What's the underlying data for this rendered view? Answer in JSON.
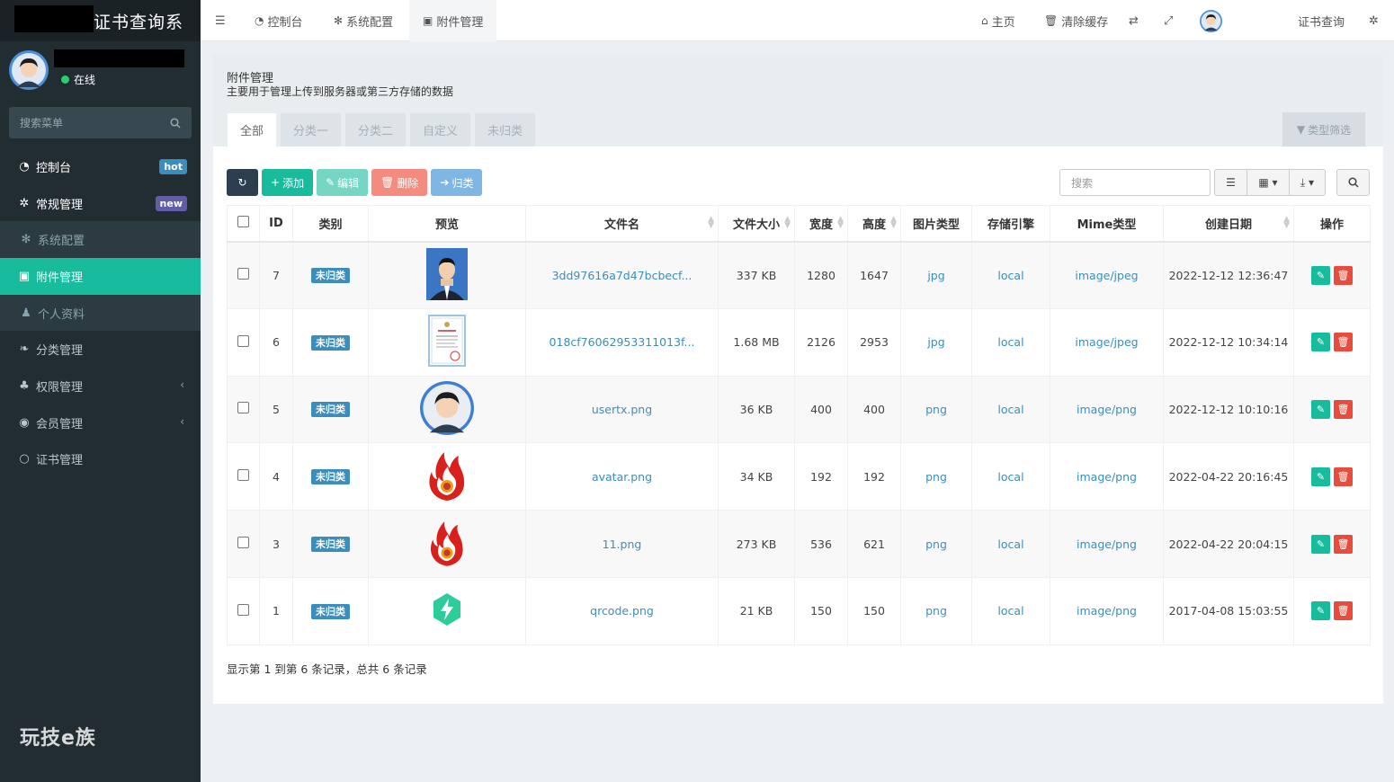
{
  "sidebar": {
    "logo_text": "证书查询系",
    "status": "在线",
    "search_placeholder": "搜索菜单",
    "items": [
      {
        "label": "控制台",
        "icon": "dashboard-icon",
        "badge": "hot"
      },
      {
        "label": "常规管理",
        "icon": "cogs-icon",
        "badge": "new"
      },
      {
        "label": "系统配置",
        "icon": "gear-icon"
      },
      {
        "label": "附件管理",
        "icon": "file-image-icon"
      },
      {
        "label": "个人资料",
        "icon": "user-icon"
      },
      {
        "label": "分类管理",
        "icon": "leaf-icon"
      },
      {
        "label": "权限管理",
        "icon": "group-icon"
      },
      {
        "label": "会员管理",
        "icon": "user-circle-icon"
      },
      {
        "label": "证书管理",
        "icon": "circle-icon"
      }
    ],
    "brand_bottom": "玩技e族"
  },
  "header": {
    "tabs": [
      "控制台",
      "系统配置",
      "附件管理"
    ],
    "home": "主页",
    "clear_cache": "清除缓存",
    "right_link": "证书查询"
  },
  "panel": {
    "title": "附件管理",
    "description": "主要用于管理上传到服务器或第三方存储的数据",
    "tabs": [
      "全部",
      "分类一",
      "分类二",
      "自定义",
      "未归类"
    ],
    "type_filter": "类型筛选"
  },
  "toolbar": {
    "add": "添加",
    "edit": "编辑",
    "delete": "删除",
    "classify": "归类",
    "search_placeholder": "搜索"
  },
  "table": {
    "headers": [
      "ID",
      "类别",
      "预览",
      "文件名",
      "文件大小",
      "宽度",
      "高度",
      "图片类型",
      "存储引擎",
      "Mime类型",
      "创建日期",
      "操作"
    ],
    "rows": [
      {
        "id": "7",
        "category": "未归类",
        "preview": "portrait-photo",
        "filename": "3dd97616a7d47bcbecf...",
        "size": "337 KB",
        "width": "1280",
        "height": "1647",
        "type": "jpg",
        "engine": "local",
        "mime": "image/jpeg",
        "date": "2022-12-12 12:36:47"
      },
      {
        "id": "6",
        "category": "未归类",
        "preview": "certificate-image",
        "filename": "018cf76062953311013f...",
        "size": "1.68 MB",
        "width": "2126",
        "height": "2953",
        "type": "jpg",
        "engine": "local",
        "mime": "image/jpeg",
        "date": "2022-12-12 10:34:14"
      },
      {
        "id": "5",
        "category": "未归类",
        "preview": "avatar-image",
        "filename": "usertx.png",
        "size": "36 KB",
        "width": "400",
        "height": "400",
        "type": "png",
        "engine": "local",
        "mime": "image/png",
        "date": "2022-12-12 10:10:16"
      },
      {
        "id": "4",
        "category": "未归类",
        "preview": "flame-logo",
        "filename": "avatar.png",
        "size": "34 KB",
        "width": "192",
        "height": "192",
        "type": "png",
        "engine": "local",
        "mime": "image/png",
        "date": "2022-04-22 20:16:45"
      },
      {
        "id": "3",
        "category": "未归类",
        "preview": "flame-logo-small",
        "filename": "11.png",
        "size": "273 KB",
        "width": "536",
        "height": "621",
        "type": "png",
        "engine": "local",
        "mime": "image/png",
        "date": "2022-04-22 20:04:15"
      },
      {
        "id": "1",
        "category": "未归类",
        "preview": "bolt-icon",
        "filename": "qrcode.png",
        "size": "21 KB",
        "width": "150",
        "height": "150",
        "type": "png",
        "engine": "local",
        "mime": "image/png",
        "date": "2017-04-08 15:03:55"
      }
    ]
  },
  "pagination_text": "显示第 1 到第 6 条记录，总共 6 条记录",
  "colors": {
    "sidebar_bg": "#222d32",
    "accent": "#18bc9c",
    "primary": "#3c8dbc",
    "danger": "#e74c3c",
    "dark": "#2c3e50"
  }
}
